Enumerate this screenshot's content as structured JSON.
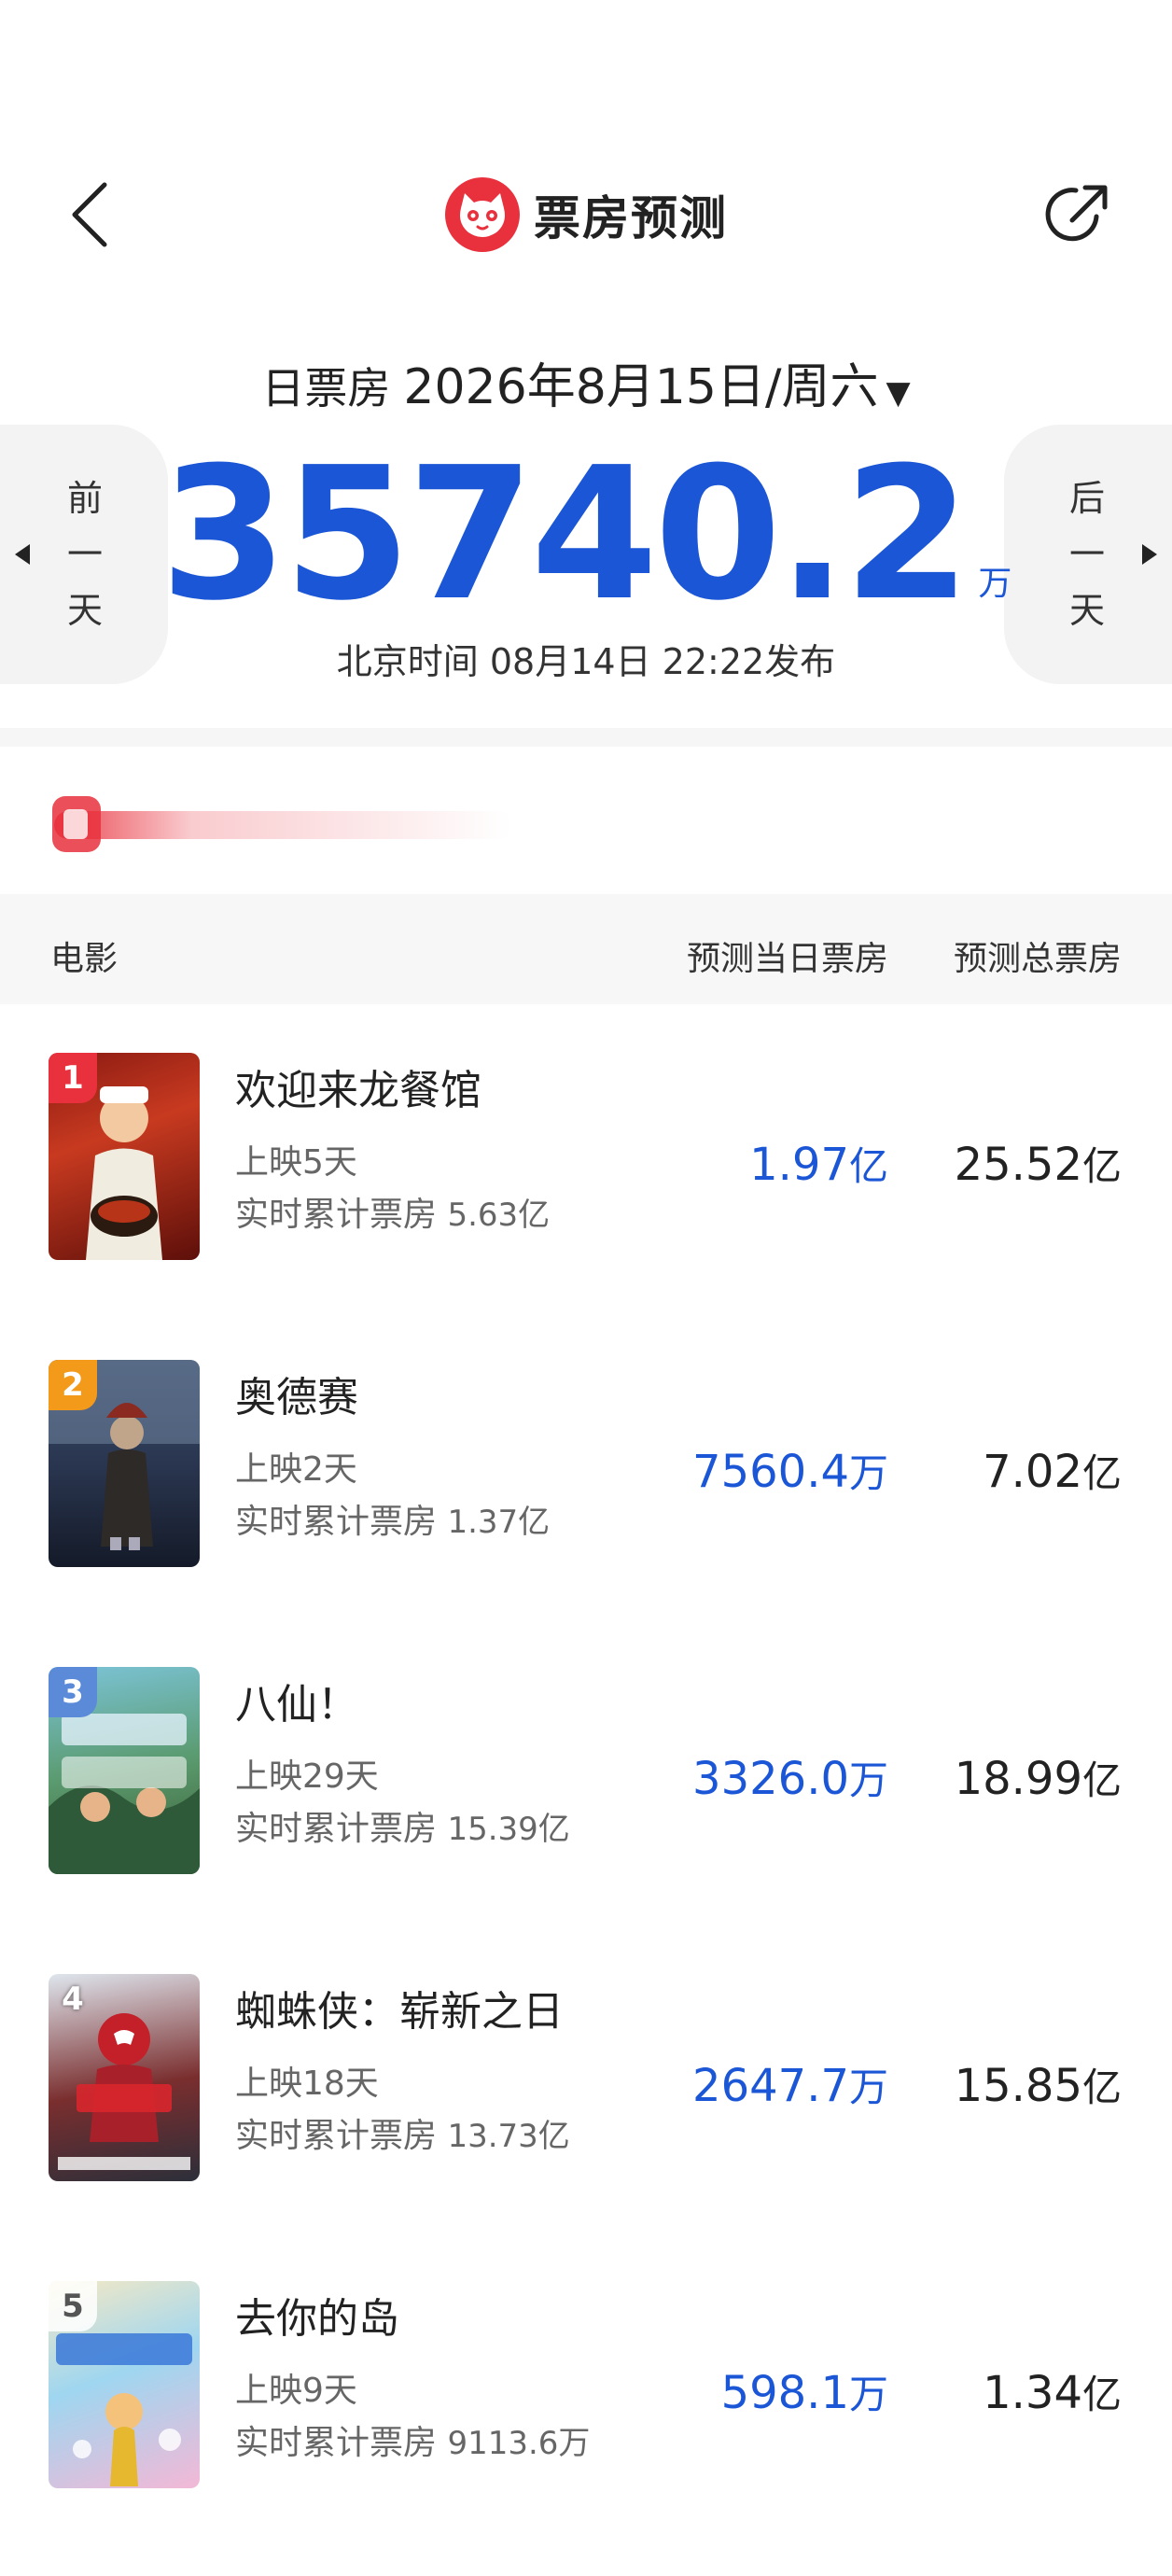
{
  "header": {
    "title": "票房预测",
    "back_icon": "chevron-left-icon",
    "share_icon": "share-icon"
  },
  "date_selector": {
    "label": "日票房",
    "date": "2026年8月15日/周六",
    "caret": "▼"
  },
  "prev_day": {
    "chars": [
      "前",
      "一",
      "天"
    ]
  },
  "next_day": {
    "chars": [
      "后",
      "一",
      "天"
    ]
  },
  "summary": {
    "total": "35740.2",
    "unit": "万",
    "publish_time": "北京时间  08月14日  22:22发布"
  },
  "table": {
    "col_movie": "电影",
    "col_day": "预测当日票房",
    "col_total": "预测总票房"
  },
  "movies": [
    {
      "rank": "1",
      "title": "欢迎来龙餐馆",
      "days": "上映5天",
      "cum_label": "实时累计票房",
      "cum_value": "5.63亿",
      "day_num": "1.97",
      "day_unit": "亿",
      "total_num": "25.52",
      "total_unit": "亿"
    },
    {
      "rank": "2",
      "title": "奥德赛",
      "days": "上映2天",
      "cum_label": "实时累计票房",
      "cum_value": "1.37亿",
      "day_num": "7560.4",
      "day_unit": "万",
      "total_num": "7.02",
      "total_unit": "亿"
    },
    {
      "rank": "3",
      "title": "八仙！",
      "days": "上映29天",
      "cum_label": "实时累计票房",
      "cum_value": "15.39亿",
      "day_num": "3326.0",
      "day_unit": "万",
      "total_num": "18.99",
      "total_unit": "亿"
    },
    {
      "rank": "4",
      "title": "蜘蛛侠：崭新之日",
      "days": "上映18天",
      "cum_label": "实时累计票房",
      "cum_value": "13.73亿",
      "day_num": "2647.7",
      "day_unit": "万",
      "total_num": "15.85",
      "total_unit": "亿"
    },
    {
      "rank": "5",
      "title": "去你的岛",
      "days": "上映9天",
      "cum_label": "实时累计票房",
      "cum_value": "9113.6万",
      "day_num": "598.1",
      "day_unit": "万",
      "total_num": "1.34",
      "total_unit": "亿"
    }
  ],
  "colors": {
    "accent_blue": "#1b56d6",
    "brand_red": "#e8313d"
  }
}
